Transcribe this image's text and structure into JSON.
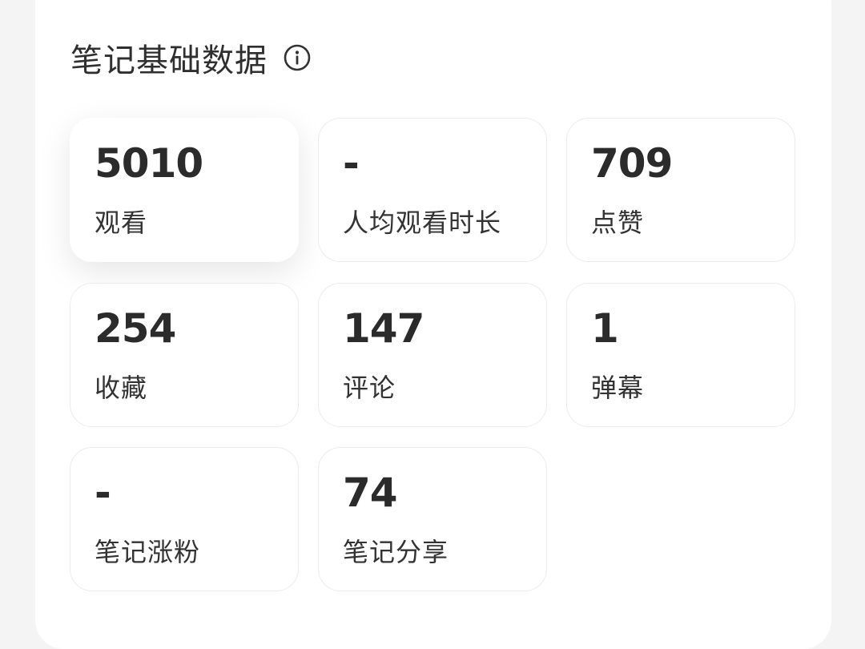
{
  "section": {
    "title": "笔记基础数据",
    "info_icon": "info-circle-icon"
  },
  "metrics": [
    {
      "value": "5010",
      "label": "观看"
    },
    {
      "value": "-",
      "label": "人均观看时长"
    },
    {
      "value": "709",
      "label": "点赞"
    },
    {
      "value": "254",
      "label": "收藏"
    },
    {
      "value": "147",
      "label": "评论"
    },
    {
      "value": "1",
      "label": "弹幕"
    },
    {
      "value": "-",
      "label": "笔记涨粉"
    },
    {
      "value": "74",
      "label": "笔记分享"
    }
  ],
  "colors": {
    "background": "#f4f4f4",
    "card": "#ffffff",
    "text": "#2b2b2b",
    "tile_border": "#ececec"
  }
}
